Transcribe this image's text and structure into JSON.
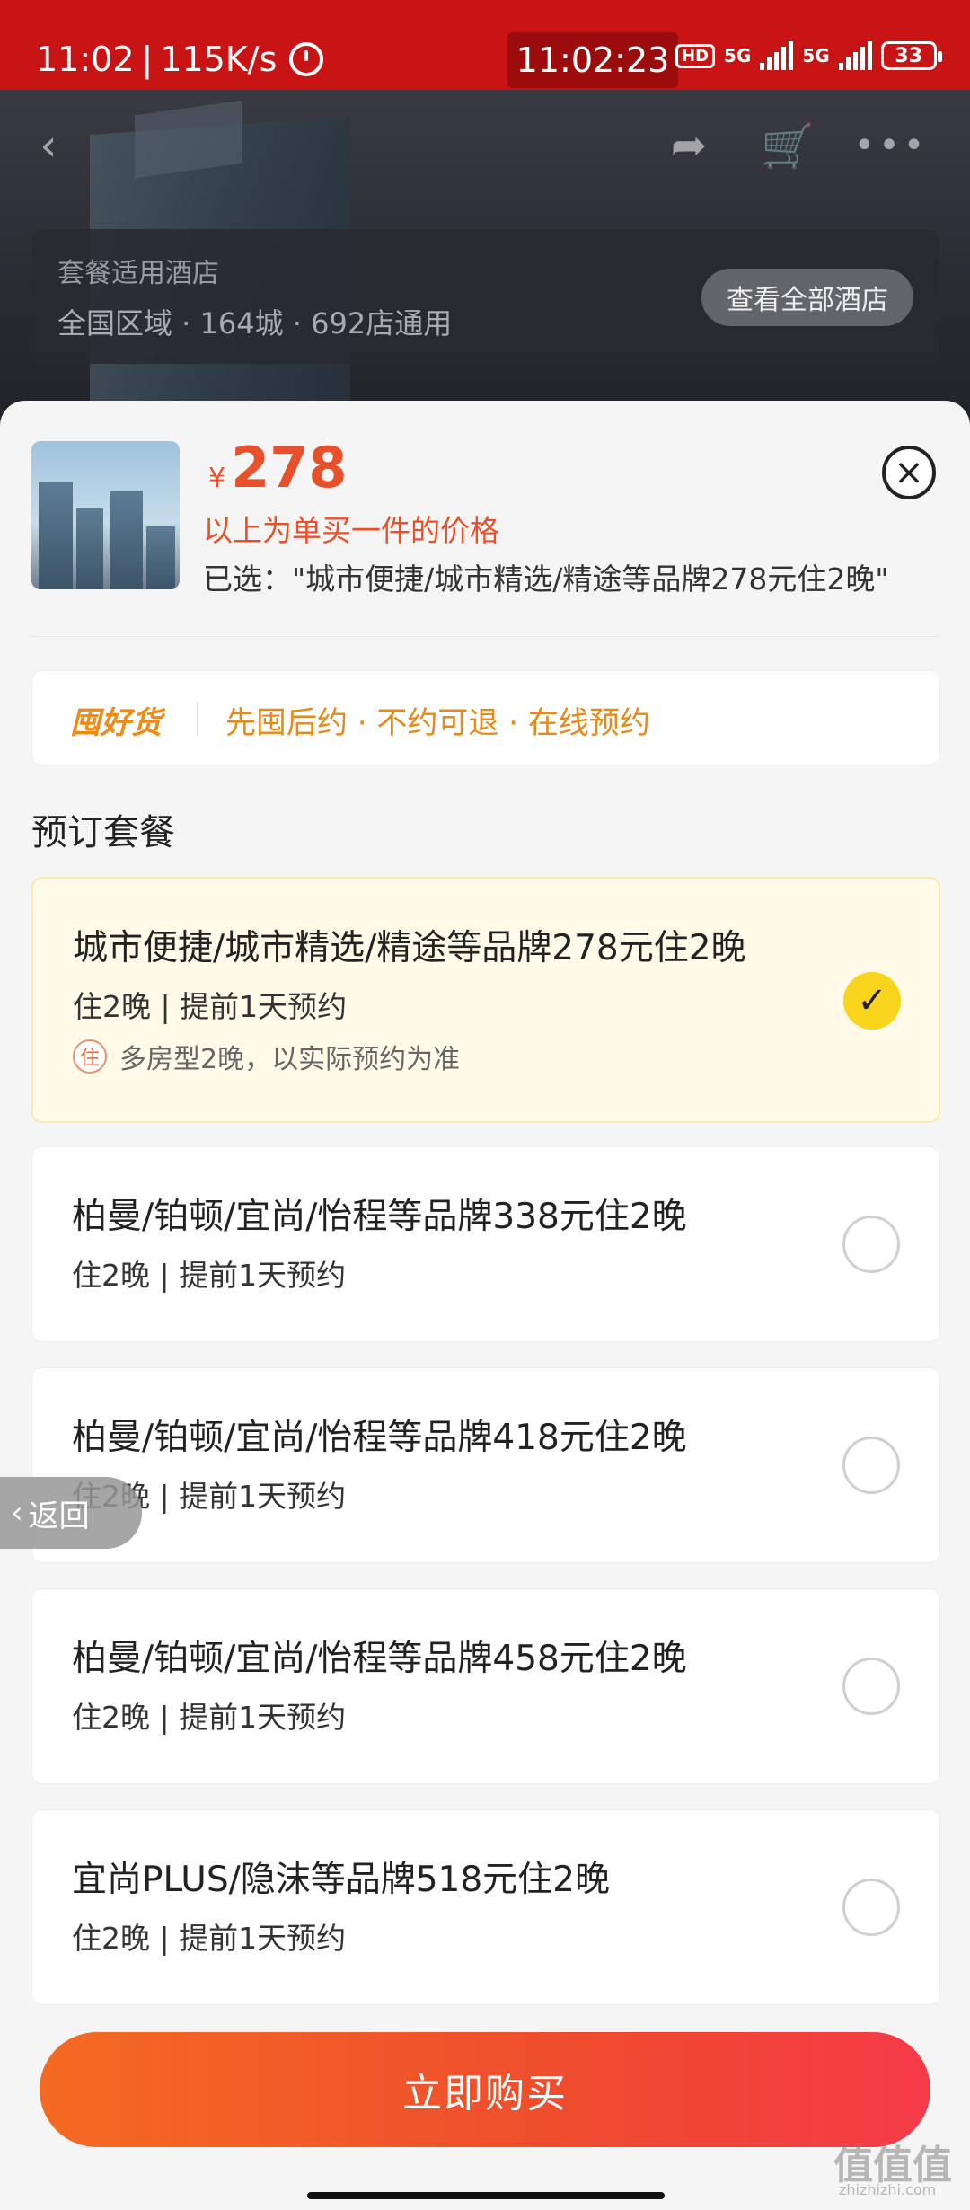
{
  "status_bar": {
    "time": "11:02",
    "speed": "115K/s",
    "clock": "11:02:23",
    "hd": "HD",
    "net1": "5G",
    "net2": "5G",
    "battery": "33"
  },
  "hero": {
    "card_title": "套餐适用酒店",
    "card_subtitle": "全国区域 · 164城 · 692店通用",
    "view_all_button": "查看全部酒店"
  },
  "product": {
    "currency": "¥",
    "price": "278",
    "price_note": "以上为单买一件的价格",
    "selected": "已选：\"城市便捷/城市精选/精途等品牌278元住2晚\""
  },
  "promo": {
    "logo": "囤好货",
    "text": "先囤后约 · 不约可退 · 在线预约"
  },
  "section_title": "预订套餐",
  "packages": [
    {
      "name": "城市便捷/城市精选/精途等品牌278元住2晚",
      "detail": "住2晚 | 提前1天预约",
      "note_badge": "住",
      "note": "多房型2晚，以实际预约为准",
      "selected": true
    },
    {
      "name": "柏曼/铂顿/宜尚/怡程等品牌338元住2晚",
      "detail": "住2晚 | 提前1天预约",
      "selected": false
    },
    {
      "name": "柏曼/铂顿/宜尚/怡程等品牌418元住2晚",
      "detail": "住2晚 | 提前1天预约",
      "selected": false
    },
    {
      "name": "柏曼/铂顿/宜尚/怡程等品牌458元住2晚",
      "detail": "住2晚 | 提前1天预约",
      "selected": false
    },
    {
      "name": "宜尚PLUS/隐沫等品牌518元住2晚",
      "detail": "住2晚 | 提前1天预约",
      "selected": false
    }
  ],
  "floating_back": "返回",
  "buy_button": "立即购买",
  "watermark": "值值值",
  "watermark_url": "zhizhizhi.com",
  "colors": {
    "status_bar": "#c81414",
    "accent": "#e8502c",
    "promo": "#e58a1a",
    "check": "#f8d51c"
  }
}
